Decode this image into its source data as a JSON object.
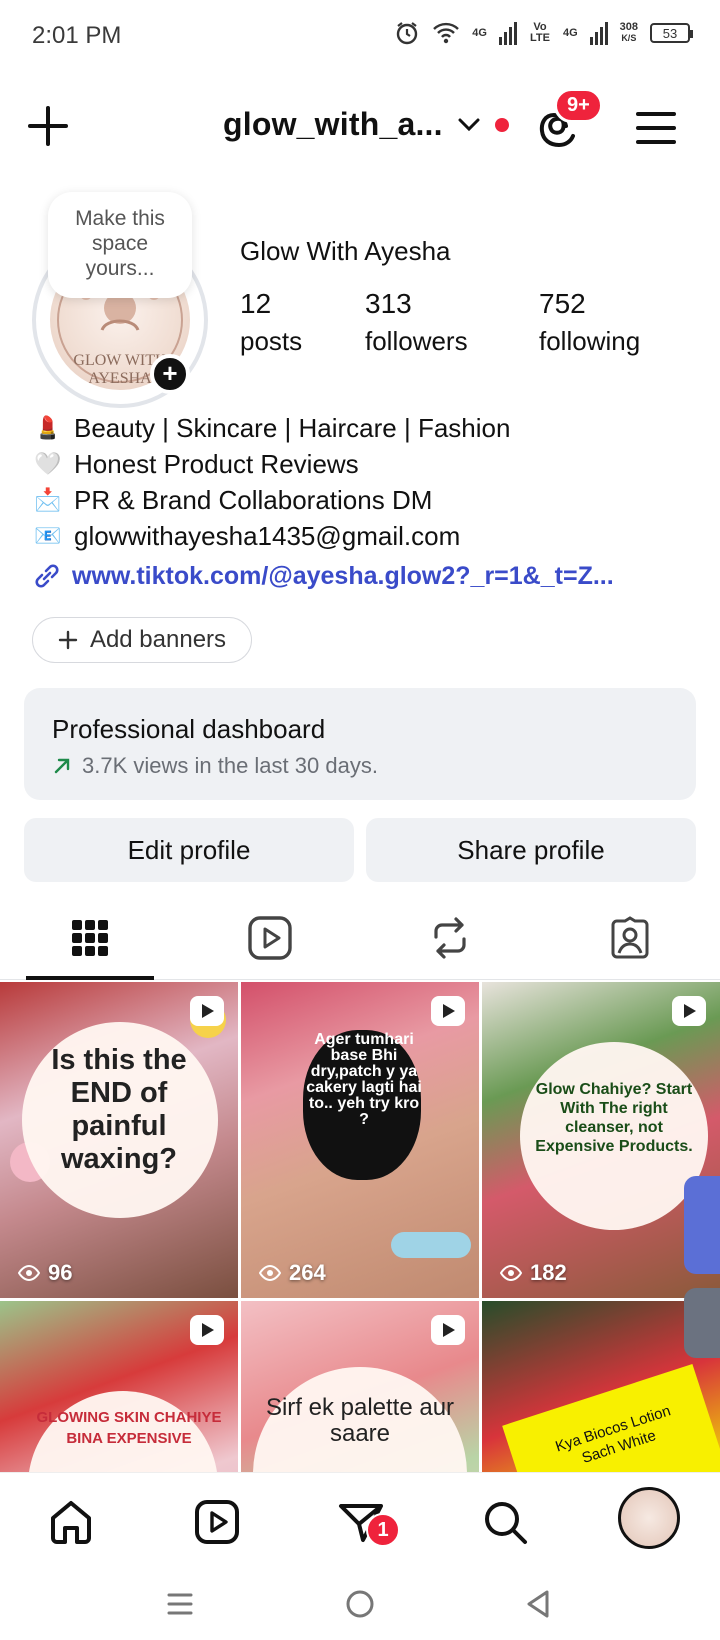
{
  "status_bar": {
    "time": "2:01 PM",
    "network1": "4G",
    "volte": "Vo LTE",
    "network2": "4G",
    "speed": "308",
    "speed_unit": "K/S",
    "battery": "53"
  },
  "header": {
    "username": "glow_with_a...",
    "notif_badge": "9+"
  },
  "profile": {
    "note": "Make this space yours...",
    "avatar_text": "GLOW WITH AYESHA",
    "display_name": "Glow With Ayesha",
    "stats": [
      {
        "num": "12",
        "label": "posts"
      },
      {
        "num": "313",
        "label": "followers"
      },
      {
        "num": "752",
        "label": "following"
      }
    ],
    "bio": [
      {
        "emoji": "💄",
        "text": "Beauty | Skincare | Haircare | Fashion"
      },
      {
        "emoji": "🤍",
        "text": "Honest Product Reviews"
      },
      {
        "emoji": "📩",
        "text": "PR & Brand Collaborations DM"
      },
      {
        "emoji": "📧",
        "text": "glowwithayesha1435@gmail.com"
      }
    ],
    "link": "www.tiktok.com/@ayesha.glow2?_r=1&_t=Z...",
    "add_banners": "Add banners"
  },
  "dashboard": {
    "title": "Professional dashboard",
    "subtitle": "3.7K views in the last 30 days."
  },
  "buttons": {
    "edit": "Edit profile",
    "share": "Share profile"
  },
  "grid": [
    {
      "text": "Is this the END of painful waxing?",
      "views": "96"
    },
    {
      "text": "Ager tumhari base Bhi dry,patch y ya cakery lagti hai to.. yeh try kro ?",
      "views": "264"
    },
    {
      "text": "Glow Chahiye? Start With The right cleanser, not Expensive Products.",
      "views": "182"
    },
    {
      "text": "GLOWING SKIN CHAHIYE BINA EXPENSIVE",
      "views": ""
    },
    {
      "text": "Sirf ek palette aur saare",
      "views": ""
    },
    {
      "text": "Kya Biocos Lotion Sach White",
      "views": ""
    }
  ],
  "bottom_nav": {
    "messages_badge": "1"
  },
  "colors": {
    "accent_red": "#ef233c",
    "link_blue": "#3a4bc9",
    "surface": "#eff1f4"
  }
}
